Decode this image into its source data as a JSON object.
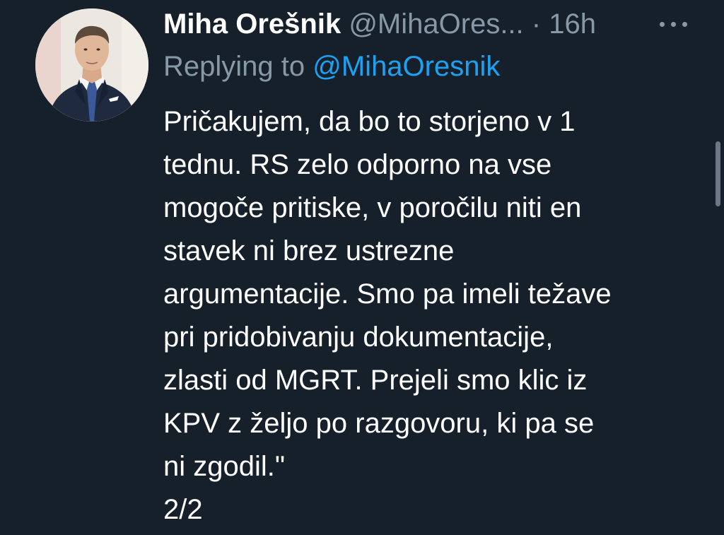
{
  "tweet": {
    "author_name": "Miha Orešnik",
    "author_handle": "@MihaOres...",
    "separator": "·",
    "timestamp": "16h",
    "more_icon": "more-horizontal-icon",
    "reply_label": "Replying to",
    "reply_to_handle": "@MihaOresnik",
    "body_lines": [
      "Pričakujem, da bo to storjeno v 1",
      "tednu. RS zelo odporno na vse",
      "mogoče pritiske, v poročilu niti en",
      "stavek ni brez ustrezne",
      "argumentacije. Smo pa imeli težave",
      "pri pridobivanju dokumentacije,",
      "zlasti od MGRT. Prejeli smo klic iz",
      "KPV z željo po razgovoru, ki pa se",
      "ni zgodil.\"",
      "2/2"
    ]
  },
  "colors": {
    "background": "#15202b",
    "primary_text": "#ffffff",
    "secondary_text": "#8899a6",
    "link": "#1da1f2"
  }
}
